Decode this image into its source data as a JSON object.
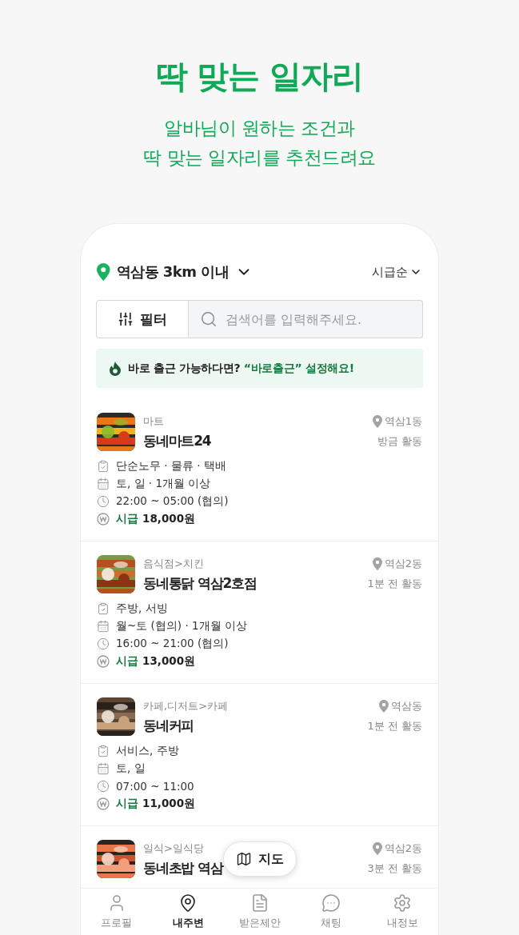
{
  "hero": {
    "title": "딱 맞는 일자리",
    "subtitle_lines": [
      "알바님이 원하는 조건과",
      "딱 맞는 일자리를 추천드려요"
    ]
  },
  "location": {
    "label": "역삼동 3km 이내"
  },
  "sort": {
    "label": "시급순"
  },
  "filter": {
    "label": "필터"
  },
  "search": {
    "placeholder": "검색어를 입력해주세요."
  },
  "banner": {
    "lead": "바로 출근 가능하다면?",
    "highlight": "“바로출근” 설정해요!"
  },
  "jobs": [
    {
      "thumbnail": {
        "kind": "picture"
      },
      "category": "마트",
      "title": "동네마트24",
      "area": "역삼1동",
      "activity": "방금 활동",
      "details": [
        {
          "kind": "task",
          "text": "단순노무 · 물류 · 택배"
        },
        {
          "kind": "days",
          "text": "토, 일 · 1개월 이상"
        },
        {
          "kind": "time",
          "text": "22:00 ~ 05:00 (협의)"
        }
      ],
      "pay": {
        "label": "시급",
        "amount": "18,000원"
      }
    },
    {
      "thumbnail": {
        "kind": "picture"
      },
      "category": "음식점>치킨",
      "title": "동네통닭 역삼2호점",
      "area": "역삼2동",
      "activity": "1분 전 활동",
      "details": [
        {
          "kind": "task",
          "text": "주방, 서빙"
        },
        {
          "kind": "days",
          "text": "월~토 (협의) · 1개월 이상"
        },
        {
          "kind": "time",
          "text": "16:00 ~ 21:00 (협의)"
        }
      ],
      "pay": {
        "label": "시급",
        "amount": "13,000원"
      }
    },
    {
      "thumbnail": {
        "kind": "picture"
      },
      "category": "카페,디저트>카페",
      "title": "동네커피",
      "area": "역삼동",
      "activity": "1분 전 활동",
      "details": [
        {
          "kind": "task",
          "text": "서비스, 주방"
        },
        {
          "kind": "days",
          "text": "토, 일"
        },
        {
          "kind": "time",
          "text": "07:00 ~ 11:00"
        }
      ],
      "pay": {
        "label": "시급",
        "amount": "11,000원"
      }
    },
    {
      "thumbnail": {
        "kind": "picture"
      },
      "category": "일식>일식당",
      "title": "동네초밥 역삼",
      "area": "역삼2동",
      "activity": "3분 전 활동"
    }
  ],
  "map_button": {
    "label": "지도"
  },
  "nav": [
    {
      "kind": "profile",
      "label": "프로필",
      "selected": false
    },
    {
      "kind": "nearby",
      "label": "내주변",
      "selected": true
    },
    {
      "kind": "offers",
      "label": "받은제안",
      "selected": false
    },
    {
      "kind": "chat",
      "label": "채팅",
      "selected": false
    },
    {
      "kind": "settings",
      "label": "내정보",
      "selected": false
    }
  ]
}
